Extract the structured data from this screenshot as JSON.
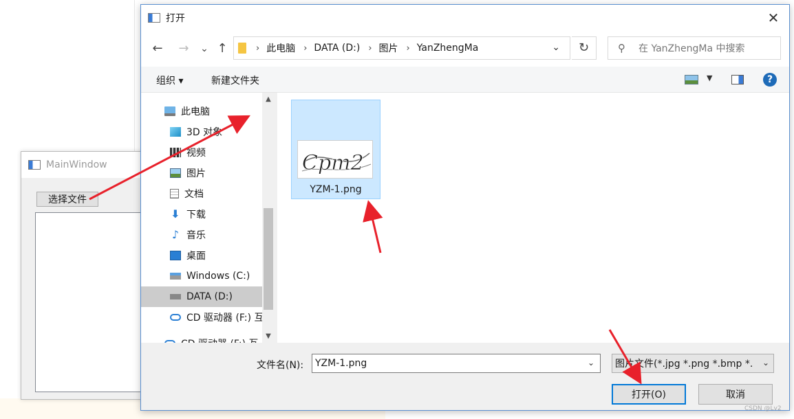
{
  "main_window": {
    "title": "MainWindow",
    "choose_file_button": "选择文件"
  },
  "dialog": {
    "title": "打开",
    "close": "✕",
    "nav": {
      "back": "←",
      "forward": "→",
      "recent": "⌄",
      "up": "↑",
      "refresh": "↻"
    },
    "address": {
      "crumbs": [
        "此电脑",
        "DATA (D:)",
        "图片",
        "YanZhengMa"
      ],
      "separator": "›"
    },
    "search_placeholder": "在 YanZhengMa 中搜索",
    "toolbar": {
      "organize": "组织 ▾",
      "new_folder": "新建文件夹",
      "help": "?"
    },
    "nav_pane": {
      "items": [
        {
          "label": "此电脑",
          "icon": "computer-icon"
        },
        {
          "label": "3D 对象",
          "icon": "cube-icon"
        },
        {
          "label": "视频",
          "icon": "video-icon"
        },
        {
          "label": "图片",
          "icon": "pictures-icon"
        },
        {
          "label": "文档",
          "icon": "document-icon"
        },
        {
          "label": "下载",
          "icon": "download-icon"
        },
        {
          "label": "音乐",
          "icon": "music-icon"
        },
        {
          "label": "桌面",
          "icon": "desktop-icon"
        },
        {
          "label": "Windows (C:)",
          "icon": "drive-icon"
        },
        {
          "label": "DATA (D:)",
          "icon": "drive-icon",
          "selected": true
        },
        {
          "label": "CD 驱动器 (F:) 互",
          "icon": "cd-drive-icon"
        },
        {
          "label": "CD 驱动器 (F:) 互",
          "icon": "cd-drive-icon"
        }
      ]
    },
    "files": [
      {
        "name": "YZM-1.png",
        "thumb_text": "Cpm2",
        "selected": true
      }
    ],
    "bottom": {
      "filename_label": "文件名(N):",
      "filename_value": "YZM-1.png",
      "filetype": "图片文件(*.jpg *.png *.bmp *.",
      "open_button": "打开(O)",
      "cancel_button": "取消"
    }
  },
  "watermark": "CSDN @Lv2",
  "colors": {
    "selection": "#cce8ff",
    "accent": "#0078d7",
    "annotation": "#e8212b"
  }
}
